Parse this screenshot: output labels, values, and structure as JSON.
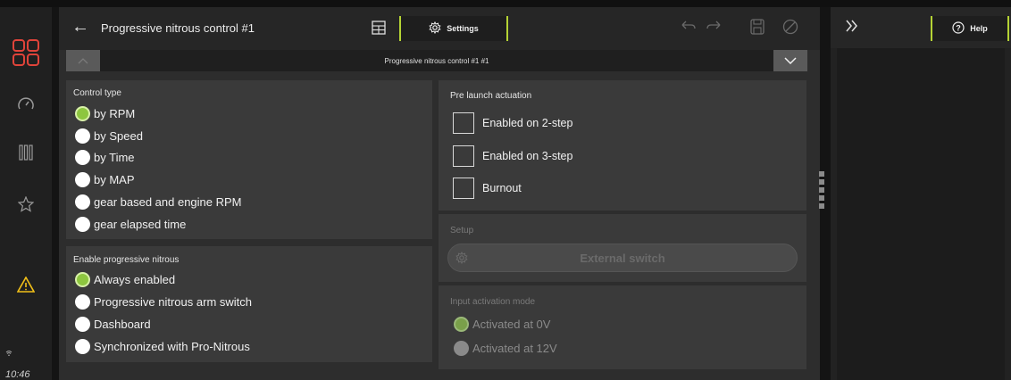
{
  "header": {
    "title": "Progressive nitrous control #1",
    "settings_label": "Settings",
    "dropdown_value": "Progressive nitrous control #1 #1"
  },
  "control_type": {
    "title": "Control type",
    "options": [
      "by RPM",
      "by Speed",
      "by Time",
      "by MAP",
      "gear based and engine RPM",
      "gear elapsed time"
    ],
    "selected": "by RPM"
  },
  "enable_progressive": {
    "title": "Enable progressive nitrous",
    "options": [
      "Always enabled",
      "Progressive nitrous arm switch",
      "Dashboard",
      "Synchronized with Pro-Nitrous"
    ],
    "selected": "Always enabled"
  },
  "pre_launch": {
    "title": "Pre launch actuation",
    "options": [
      "Enabled on 2-step",
      "Enabled on 3-step",
      "Burnout"
    ]
  },
  "setup": {
    "title": "Setup",
    "button_label": "External switch"
  },
  "input_activation": {
    "title": "Input activation mode",
    "options": [
      "Activated at 0V",
      "Activated at 12V"
    ],
    "selected": "Activated at 0V"
  },
  "right_panel": {
    "help_label": "Help"
  },
  "status": {
    "clock": "10:46"
  },
  "colors": {
    "accent": "#b5d334",
    "selected_radio": "#8dc63f",
    "logo": "#e0443a",
    "warning": "#f2c018"
  }
}
